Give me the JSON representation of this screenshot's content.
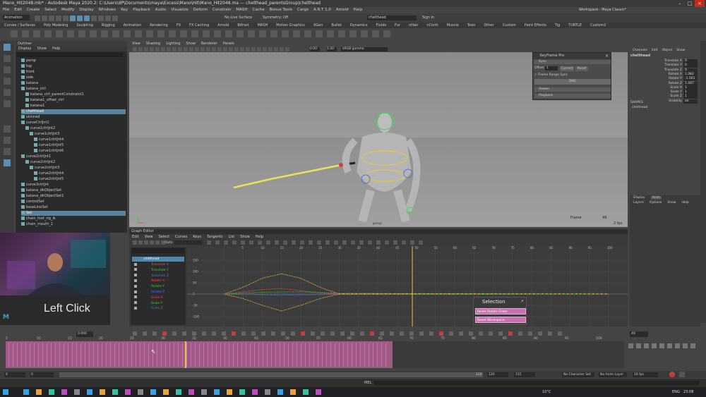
{
  "window": {
    "title": "Mano_Hit2048.mb* - Autodesk Maya 2020.2: C:\\Users\\dP\\Documents\\maya\\Excess\\Mano\\Hit\\Mano_Hit2048.ma --- chelthead_parentsGroup|chelthead"
  },
  "menubar": {
    "items": [
      "File",
      "Edit",
      "Create",
      "Select",
      "Modify",
      "Display",
      "Windows",
      "Key",
      "Playback",
      "Audio",
      "Visualize",
      "Deform",
      "Constrain",
      "MASH",
      "Cache",
      "Bonus Tools",
      "Cargo",
      "A.R.T 1.0",
      "Arnold",
      "Help"
    ],
    "workspace": "Workspace : Maya Classic*"
  },
  "shelfbar": {
    "mode": "Animation",
    "no_live_surface": "No Live Surface",
    "symmetry": "Symmetry: Off",
    "search_value": "chelthead",
    "sign_in": "Sign In"
  },
  "shelftabs": [
    "Curves / Surfaces",
    "Poly Modeling",
    "Sculpting",
    "Rigging",
    "Animation",
    "Rendering",
    "FX",
    "FX Caching",
    "Arnold",
    "Bifrost",
    "MASH",
    "Motion Graphics",
    "XGen",
    "Bullet",
    "Dynamics",
    "Fluids",
    "Fur",
    "nHair",
    "nCloth",
    "Muscle",
    "Toon",
    "Other",
    "Custom",
    "Paint Effects",
    "Tig",
    "TURTLE",
    "Custom2"
  ],
  "outliner": {
    "title": "Outliner",
    "menu": [
      "Display",
      "Show",
      "Help"
    ],
    "rows": [
      {
        "label": "persp",
        "sel": false,
        "indent": 0
      },
      {
        "label": "top",
        "sel": false,
        "indent": 0
      },
      {
        "label": "front",
        "sel": false,
        "indent": 0
      },
      {
        "label": "side",
        "sel": false,
        "indent": 0
      },
      {
        "label": "katana",
        "sel": false,
        "indent": 0
      },
      {
        "label": "katana_ctrl",
        "sel": false,
        "indent": 0
      },
      {
        "label": "katana_ctrl_parentConstraint1",
        "sel": false,
        "indent": 1
      },
      {
        "label": "katana1_offset_ctrl",
        "sel": false,
        "indent": 1
      },
      {
        "label": "katana1",
        "sel": false,
        "indent": 1
      },
      {
        "label": "chelthead",
        "sel": true,
        "indent": 0
      },
      {
        "label": "skinned",
        "sel": false,
        "indent": 0
      },
      {
        "label": "curveCtrlJnt1",
        "sel": false,
        "indent": 0
      },
      {
        "label": "curve1ctrlJnt2",
        "sel": false,
        "indent": 1
      },
      {
        "label": "curve1ctrlJnt3",
        "sel": false,
        "indent": 2
      },
      {
        "label": "curve1ctrlJnt4",
        "sel": false,
        "indent": 3
      },
      {
        "label": "curve1ctrlJnt5",
        "sel": false,
        "indent": 3
      },
      {
        "label": "curve1ctrlJnt6",
        "sel": false,
        "indent": 3
      },
      {
        "label": "curve2ctrlJnt1",
        "sel": false,
        "indent": 0
      },
      {
        "label": "curve2ctrlJnt2",
        "sel": false,
        "indent": 1
      },
      {
        "label": "curve2ctrlJnt3",
        "sel": false,
        "indent": 2
      },
      {
        "label": "curve2ctrlJnt4",
        "sel": false,
        "indent": 3
      },
      {
        "label": "curve2ctrlJnt5",
        "sel": false,
        "indent": 3
      },
      {
        "label": "curve3ctrlJnt",
        "sel": false,
        "indent": 0
      },
      {
        "label": "katana_dkObjectSet",
        "sel": false,
        "indent": 0
      },
      {
        "label": "katana_dkObjectSet1",
        "sel": false,
        "indent": 0
      },
      {
        "label": "controlSet",
        "sel": false,
        "indent": 0
      },
      {
        "label": "baseLineSet",
        "sel": false,
        "indent": 0
      },
      {
        "label": "Set",
        "sel": true,
        "indent": 0
      },
      {
        "label": "chain_foot_rig_ik",
        "sel": false,
        "indent": 0
      },
      {
        "label": "chain_mouth_1",
        "sel": false,
        "indent": 0
      }
    ]
  },
  "viewport": {
    "menu": [
      "View",
      "Shading",
      "Lighting",
      "Show",
      "Renderer",
      "Panels"
    ],
    "field_a": "0.00",
    "field_b": "1.00",
    "colorspace": "sRGB gamma",
    "camera_label": "persp",
    "frame_label": "Frame",
    "frame_value": "49",
    "fps": "2 fps"
  },
  "keyframepro": {
    "title": "KeyFrame Pro",
    "section": "Sync",
    "offset_label": "Offset",
    "offset_value": "1",
    "current_btn": "Current",
    "reset_btn": "Reset",
    "checkbox_label": "Frame Range Sync",
    "sync_btn": "DNC",
    "viewer_label": "Viewer",
    "playback_label": "Playback"
  },
  "channelbox": {
    "menu": [
      "Channels",
      "Edit",
      "Object",
      "Show"
    ],
    "node": "chelthead",
    "attrs": [
      {
        "name": "Translate X",
        "value": "0"
      },
      {
        "name": "Translate Y",
        "value": "0"
      },
      {
        "name": "Translate Z",
        "value": "0"
      },
      {
        "name": "Rotate X",
        "value": "1.082"
      },
      {
        "name": "Rotate Y",
        "value": "-1.561"
      },
      {
        "name": "Rotate Z",
        "value": "1.447"
      },
      {
        "name": "Scale X",
        "value": "1"
      },
      {
        "name": "Scale Y",
        "value": "1"
      },
      {
        "name": "Scale Z",
        "value": "1"
      },
      {
        "name": "Visibility",
        "value": "on"
      }
    ],
    "shapes_label": "SHAPES",
    "shape_node": "chelthead"
  },
  "layers": {
    "tabs": [
      "Display",
      "Anim"
    ],
    "menu": [
      "Layers",
      "Options",
      "Show",
      "Help"
    ]
  },
  "graph_editor": {
    "title": "Graph Editor",
    "menu": [
      "Edit",
      "View",
      "Select",
      "Curves",
      "Keys",
      "Tangents",
      "List",
      "Show",
      "Help"
    ],
    "stats_label": "Stats",
    "list_header": "chelthead",
    "list_rows": [
      {
        "label": "Translate X",
        "color": "#e05050"
      },
      {
        "label": "Translate Y",
        "color": "#50c050"
      },
      {
        "label": "Translate Z",
        "color": "#5070e0"
      },
      {
        "label": "Rotate X",
        "color": "#e05050"
      },
      {
        "label": "Rotate Y",
        "color": "#50c050"
      },
      {
        "label": "Rotate Z",
        "color": "#5070e0"
      },
      {
        "label": "Scale X",
        "color": "#e05050"
      },
      {
        "label": "Scale Y",
        "color": "#50c050"
      },
      {
        "label": "Scale Z",
        "color": "#5070e0"
      }
    ],
    "y_ticks": [
      "150",
      "100",
      "50",
      "0",
      "-50",
      "-100"
    ],
    "x_ticks": [
      "5",
      "10",
      "15",
      "20",
      "25",
      "30",
      "35",
      "40",
      "45",
      "50",
      "55",
      "60",
      "65",
      "70",
      "75",
      "80",
      "85",
      "90",
      "95",
      "100"
    ],
    "current_frame": "49"
  },
  "selection_popup": {
    "title": "Selection",
    "items": [
      "Reset Rotate Order",
      "Reset Workspace"
    ]
  },
  "webcam": {
    "overlay_text": "Left Click"
  },
  "timeslider": {
    "start_field": "0.000",
    "current_frame": "49",
    "ticks": [
      "5",
      "10",
      "15",
      "20",
      "25",
      "30",
      "35",
      "40",
      "45",
      "50",
      "55",
      "60",
      "65",
      "70",
      "75",
      "80",
      "85",
      "90",
      "95",
      "100"
    ]
  },
  "rangebar": {
    "start": "0",
    "start2": "0",
    "end": "120",
    "end2": "120",
    "end3": "155",
    "character_set": "No Character Set",
    "anim_layer": "No Anim Layer",
    "fps": "24 fps"
  },
  "statusbar": {
    "mel_label": "MEL"
  },
  "taskbar": {
    "weather": "10°C",
    "lang": "ENG",
    "time": "23:08"
  }
}
